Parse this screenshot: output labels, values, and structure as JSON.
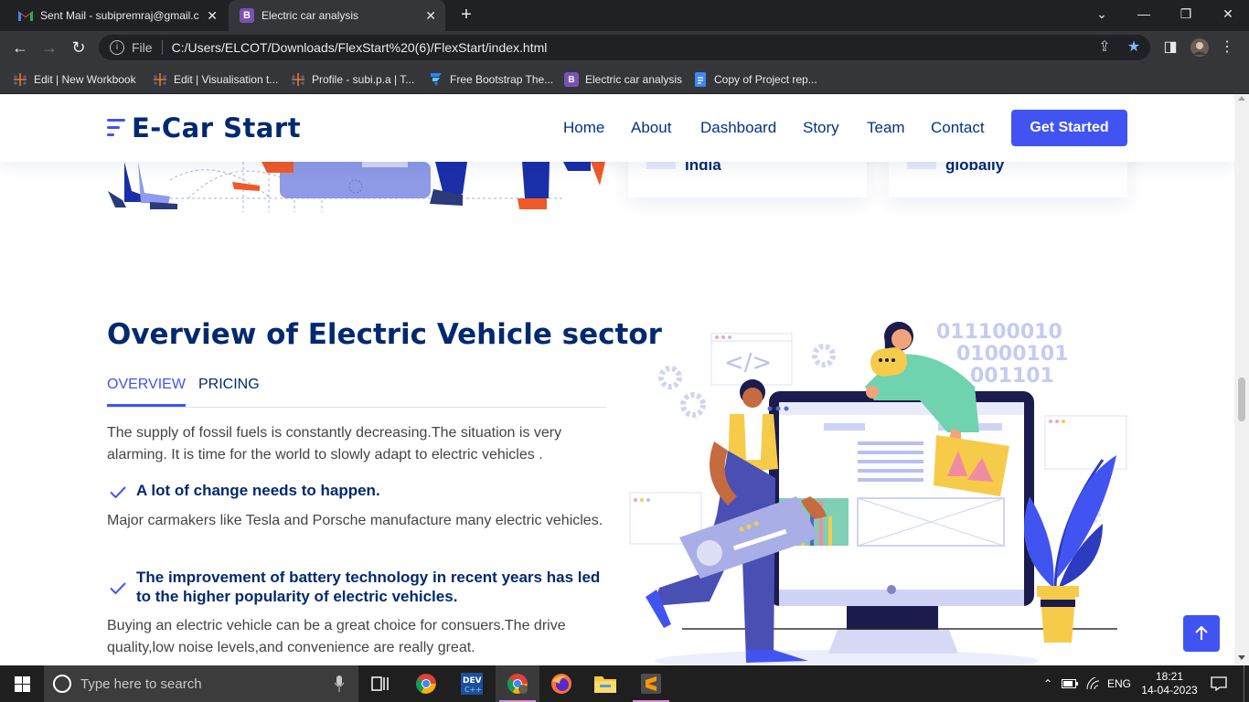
{
  "browser": {
    "tabs": [
      {
        "title": "Sent Mail - subipremraj@gmail.c",
        "icon": "gmail-icon",
        "active": false
      },
      {
        "title": "Electric car analysis",
        "icon": "bootstrap-icon",
        "active": true
      }
    ],
    "address": {
      "scheme": "File",
      "url": "C:/Users/ELCOT/Downloads/FlexStart%20(6)/FlexStart/index.html"
    },
    "bookmarks": [
      {
        "label": "Edit | New Workbook",
        "icon": "tableau-icon"
      },
      {
        "label": "Edit | Visualisation t...",
        "icon": "tableau-icon"
      },
      {
        "label": "Profile - subi.p.a | T...",
        "icon": "tableau-icon"
      },
      {
        "label": "Free Bootstrap The...",
        "icon": "flexstart-icon"
      },
      {
        "label": "Electric car analysis",
        "icon": "bootstrap-icon"
      },
      {
        "label": "Copy of Project rep...",
        "icon": "google-docs-icon"
      }
    ]
  },
  "site": {
    "logo": "E-Car Start",
    "nav": [
      "Home",
      "About",
      "Dashboard",
      "Story",
      "Team",
      "Contact"
    ],
    "cta": "Get Started",
    "cards": [
      {
        "text": "India"
      },
      {
        "text": "globally"
      }
    ],
    "section": {
      "title": "Overview of Electric Vehicle sector",
      "tabs": [
        {
          "label": "OVERVIEW",
          "active": true
        },
        {
          "label": "PRICING",
          "active": false
        }
      ],
      "intro": "The supply of fossil fuels is constantly decreasing.The situation is very alarming. It is time for the world to slowly adapt to electric vehicles .",
      "items": [
        {
          "heading": "A lot of change needs to happen.",
          "body": "Major carmakers like Tesla and Porsche manufacture many electric vehicles."
        },
        {
          "heading": "The improvement of battery technology in recent years has led to the higher popularity of electric vehicles.",
          "body": "Buying an electric vehicle can be a great choice for consuers.The drive quality,low noise levels,and convenience are really great."
        }
      ],
      "binary": [
        "011100010",
        "01000101",
        "001101"
      ]
    }
  },
  "taskbar": {
    "search_placeholder": "Type here to search",
    "language": "ENG",
    "time": "18:21",
    "date": "14-04-2023"
  },
  "colors": {
    "accent": "#4154f1",
    "heading": "#012970",
    "body_text": "#444444"
  }
}
